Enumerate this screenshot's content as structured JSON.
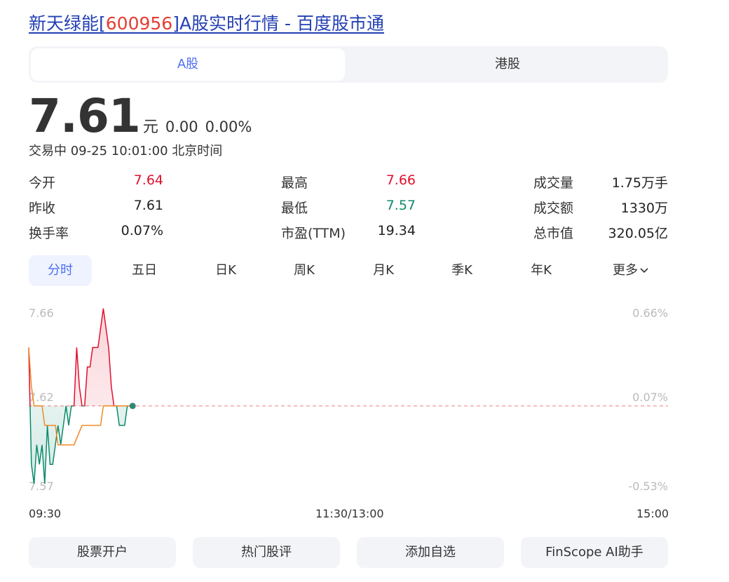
{
  "page": {
    "title_prefix": "新天绿能[",
    "title_code": "600956",
    "title_suffix": "]A股实时行情 - 百度股市通"
  },
  "tabs": [
    {
      "label": "A股",
      "active": true
    },
    {
      "label": "港股",
      "active": false
    }
  ],
  "quote": {
    "price": "7.61",
    "unit": "元",
    "change": "0.00",
    "change_pct": "0.00%",
    "status": "交易中 09-25 10:01:00 北京时间"
  },
  "stats": [
    [
      {
        "label": "今开",
        "value": "7.64",
        "color": "red"
      },
      {
        "label": "最高",
        "value": "7.66",
        "color": "red"
      },
      {
        "label": "成交量",
        "value": "1.75万手",
        "color": "normal"
      }
    ],
    [
      {
        "label": "昨收",
        "value": "7.61",
        "color": "normal"
      },
      {
        "label": "最低",
        "value": "7.57",
        "color": "green"
      },
      {
        "label": "成交额",
        "value": "1330万",
        "color": "normal"
      }
    ],
    [
      {
        "label": "换手率",
        "value": "0.07%",
        "color": "normal"
      },
      {
        "label": "市盈(TTM)",
        "value": "19.34",
        "color": "normal"
      },
      {
        "label": "总市值",
        "value": "320.05亿",
        "color": "normal"
      }
    ]
  ],
  "periods": [
    "分时",
    "五日",
    "日K",
    "周K",
    "月K",
    "季K",
    "年K",
    "更多"
  ],
  "active_period": "分时",
  "colors": {
    "up": "#e0102d",
    "down": "#0b8a6b",
    "avg": "#f08a24",
    "link": "#2440b3",
    "accent": "#4e6ef2"
  },
  "chart_data": {
    "type": "line",
    "y_left_ticks": [
      "7.66",
      "7.62",
      "7.57"
    ],
    "y_right_ticks": [
      "0.66%",
      "0.07%",
      "-0.53%"
    ],
    "x_ticks": [
      "09:30",
      "11:30/13:00",
      "15:00"
    ],
    "ylim": [
      7.57,
      7.66
    ],
    "reference": 7.61,
    "total_minutes": 240,
    "series": [
      {
        "role": "price",
        "points": [
          [
            0,
            7.64
          ],
          [
            1,
            7.58
          ],
          [
            2,
            7.57
          ],
          [
            3,
            7.59
          ],
          [
            4,
            7.58
          ],
          [
            5,
            7.59
          ],
          [
            6,
            7.57
          ],
          [
            7,
            7.6
          ],
          [
            8,
            7.58
          ],
          [
            9,
            7.58
          ],
          [
            10,
            7.59
          ],
          [
            11,
            7.6
          ],
          [
            12,
            7.59
          ],
          [
            13,
            7.6
          ],
          [
            14,
            7.61
          ],
          [
            15,
            7.6
          ],
          [
            16,
            7.61
          ],
          [
            17,
            7.61
          ],
          [
            18,
            7.64
          ],
          [
            19,
            7.62
          ],
          [
            20,
            7.61
          ],
          [
            21,
            7.61
          ],
          [
            22,
            7.63
          ],
          [
            23,
            7.63
          ],
          [
            24,
            7.64
          ],
          [
            25,
            7.64
          ],
          [
            26,
            7.64
          ],
          [
            27,
            7.65
          ],
          [
            28,
            7.66
          ],
          [
            29,
            7.65
          ],
          [
            30,
            7.64
          ],
          [
            31,
            7.62
          ],
          [
            32,
            7.61
          ],
          [
            33,
            7.61
          ],
          [
            34,
            7.6
          ],
          [
            35,
            7.6
          ],
          [
            36,
            7.6
          ],
          [
            37,
            7.61
          ],
          [
            38,
            7.61
          ],
          [
            39,
            7.61
          ]
        ]
      },
      {
        "role": "average",
        "points": [
          [
            0,
            7.64
          ],
          [
            1,
            7.62
          ],
          [
            2,
            7.61
          ],
          [
            5,
            7.61
          ],
          [
            6,
            7.6
          ],
          [
            10,
            7.6
          ],
          [
            11,
            7.59
          ],
          [
            16,
            7.59
          ],
          [
            17,
            7.59
          ],
          [
            20,
            7.6
          ],
          [
            27,
            7.6
          ],
          [
            28,
            7.61
          ],
          [
            39,
            7.61
          ]
        ]
      }
    ]
  },
  "actions": [
    "股票开户",
    "热门股评",
    "添加自选",
    "FinScope AI助手"
  ]
}
